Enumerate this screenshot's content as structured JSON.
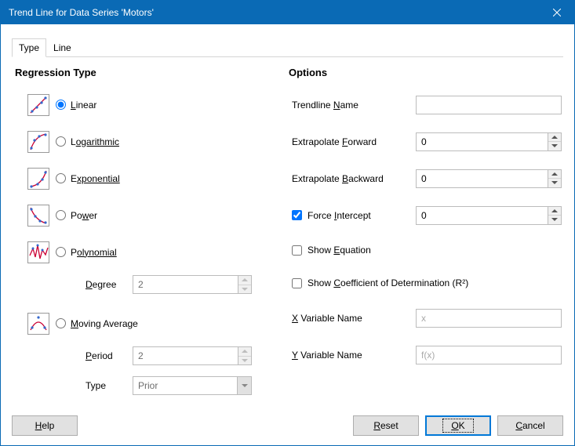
{
  "window": {
    "title": "Trend Line for Data Series 'Motors'"
  },
  "tabs": {
    "type": "Type",
    "line": "Line"
  },
  "regression": {
    "header": "Regression Type",
    "linear": "inear",
    "linear_pre": "L",
    "log_pre": "L",
    "log": "ogarithmic",
    "exp": "xponential",
    "exp_pre": "E",
    "power": "Po",
    "power_u": "w",
    "power_post": "er",
    "poly_pre": "P",
    "poly": "olynomial",
    "degree_pre": "",
    "degree_u": "D",
    "degree_post": "egree",
    "degree_val": "2",
    "ma_pre": "",
    "ma_u": "M",
    "ma_post": "oving Average",
    "period_pre": "",
    "period_u": "P",
    "period_post": "eriod",
    "period_val": "2",
    "type_label": "Type",
    "type_val": "Prior"
  },
  "options": {
    "header": "Options",
    "trendline_name_pre": "Trendline ",
    "trendline_name_u": "N",
    "trendline_name_post": "ame",
    "trendline_name_val": "",
    "extrap_fwd_pre": "Extrapolate ",
    "extrap_fwd_u": "F",
    "extrap_fwd_post": "orward",
    "extrap_fwd_val": "0",
    "extrap_bwd_pre": "Extrapolate ",
    "extrap_bwd_u": "B",
    "extrap_bwd_post": "ackward",
    "extrap_bwd_val": "0",
    "force_pre": "Force ",
    "force_u": "I",
    "force_post": "ntercept",
    "force_val": "0",
    "force_checked": true,
    "show_eq_pre": "Show ",
    "show_eq_u": "E",
    "show_eq_post": "quation",
    "show_r2_pre": "Show ",
    "show_r2_u": "C",
    "show_r2_post": "oefficient of Determination (R²)",
    "xvar_u": "X",
    "xvar_post": " Variable Name",
    "xvar_placeholder": "x",
    "yvar_u": "Y",
    "yvar_post": " Variable Name",
    "yvar_placeholder": "f(x)"
  },
  "buttons": {
    "help_u": "H",
    "help_post": "elp",
    "reset_u": "R",
    "reset_post": "eset",
    "ok_u": "O",
    "ok_post": "K",
    "cancel_u": "C",
    "cancel_post": "ancel"
  }
}
